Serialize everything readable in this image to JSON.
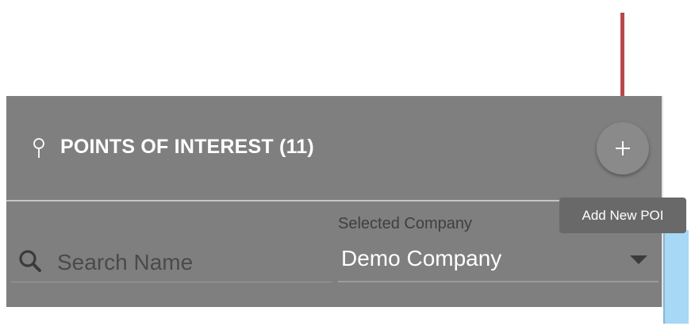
{
  "header": {
    "title": "POINTS OF INTEREST (11)",
    "icon": "map-pin-icon",
    "add_button_icon": "plus-icon",
    "tooltip": "Add New POI"
  },
  "search": {
    "placeholder": "Search Name",
    "value": "",
    "icon": "search-icon"
  },
  "company_select": {
    "label": "Selected Company",
    "value": "Demo Company",
    "icon": "chevron-down-icon"
  },
  "colors": {
    "panel_bg": "#7f7f7f",
    "annotation_arrow": "#b44b4b",
    "tooltip_bg": "#696969",
    "side_strip": "#a7d8f6"
  }
}
